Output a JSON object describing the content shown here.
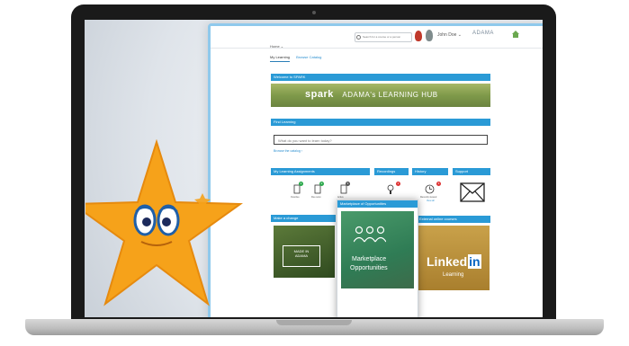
{
  "header": {
    "search_placeholder": "Search for a course or a person",
    "user_name": "John Doe ⌄",
    "brand": "ADAMA"
  },
  "nav": {
    "home_label": "Home ⌄",
    "tabs": [
      {
        "label": "My Learning",
        "active": true
      },
      {
        "label": "Browse Catalog",
        "active": false
      }
    ]
  },
  "welcome": {
    "bar_title": "Welcome to SPARK",
    "banner_brand": "spark",
    "banner_text": "ADAMA's LEARNING HUB"
  },
  "find_learning": {
    "bar_title": "Find Learning",
    "search_placeholder": "What do you want to learn today?",
    "link": "Browse the catalog ›"
  },
  "cards": {
    "assignments_title": "My Learning Assignments",
    "assignments_items": [
      {
        "label": "Overdue",
        "count": "1",
        "color": "#2aa84a"
      },
      {
        "label": "Due soon",
        "count": "2",
        "color": "#2aa84a"
      },
      {
        "label": "Active",
        "count": "3",
        "color": "#555555"
      }
    ],
    "recordings_title": "Recordings",
    "recordings_badge": "1",
    "history_title": "History",
    "history_badge": "3",
    "history_item_label": "Recently viewed",
    "history_link": "View all",
    "support_title": "Support"
  },
  "tiles": {
    "left_title": "Make a change",
    "left_logo_line1": "MADE IN",
    "left_logo_line2": "ADAMA",
    "marketplace_title": "Marketplace of Opportunities",
    "marketplace_caption_1": "Marketplace",
    "marketplace_caption_2": "Opportunities",
    "external_title": "External online courses",
    "linkedin_text": "Linked",
    "linkedin_badge": "in",
    "linkedin_sub": "Learning"
  },
  "colors": {
    "accent": "#2a9ad6",
    "banner_green": "#7f9a4a",
    "star_orange": "#f7a21b"
  },
  "icons": [
    "search-icon",
    "home-icon",
    "mail-icon",
    "clipboard-icon",
    "clock-icon",
    "star-mascot"
  ]
}
